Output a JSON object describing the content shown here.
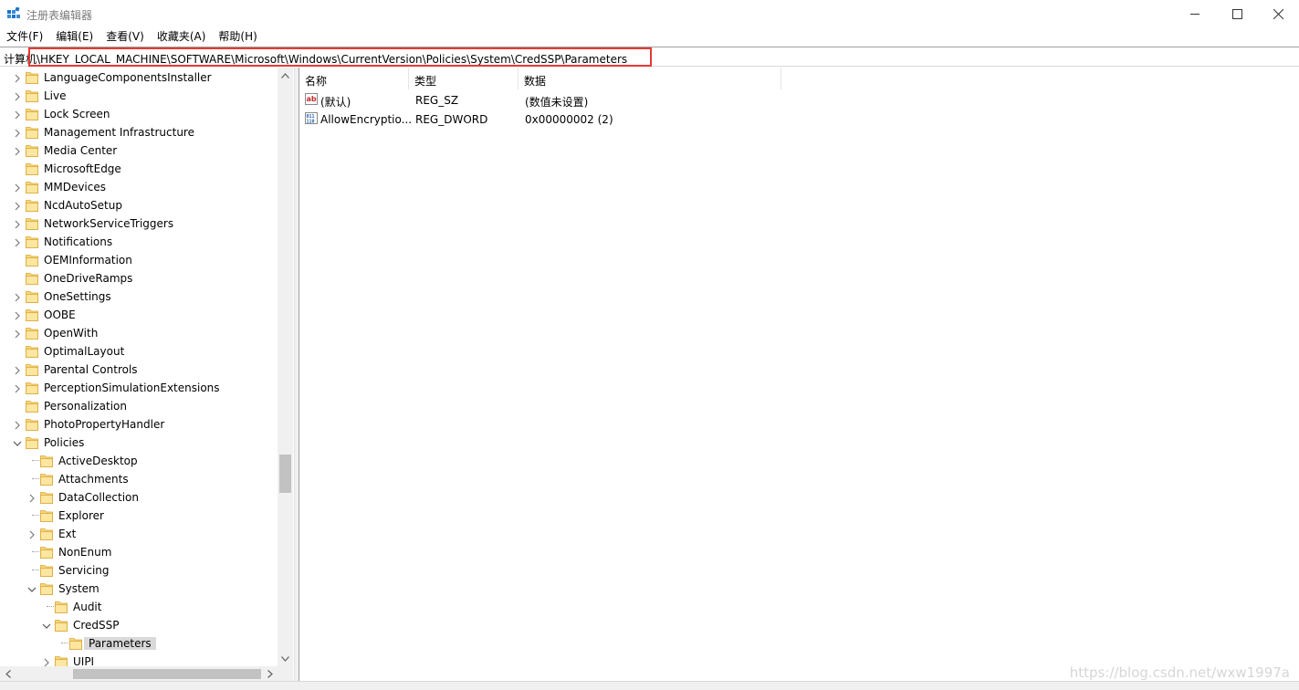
{
  "window": {
    "title": "注册表编辑器",
    "minimize_icon": "minimize-icon",
    "maximize_icon": "maximize-icon",
    "close_icon": "close-icon"
  },
  "menu": [
    "文件(F)",
    "编辑(E)",
    "查看(V)",
    "收藏夹(A)",
    "帮助(H)"
  ],
  "address": {
    "label": "计算",
    "value": "机\\HKEY_LOCAL_MACHINE\\SOFTWARE\\Microsoft\\Windows\\CurrentVersion\\Policies\\System\\CredSSP\\Parameters",
    "highlight_color": "#e53935"
  },
  "tree": [
    {
      "label": "LanguageComponentsInstaller",
      "level": 1,
      "expander": "collapsed"
    },
    {
      "label": "Live",
      "level": 1,
      "expander": "collapsed"
    },
    {
      "label": "Lock Screen",
      "level": 1,
      "expander": "collapsed"
    },
    {
      "label": "Management Infrastructure",
      "level": 1,
      "expander": "collapsed"
    },
    {
      "label": "Media Center",
      "level": 1,
      "expander": "collapsed"
    },
    {
      "label": "MicrosoftEdge",
      "level": 1,
      "expander": "none"
    },
    {
      "label": "MMDevices",
      "level": 1,
      "expander": "collapsed"
    },
    {
      "label": "NcdAutoSetup",
      "level": 1,
      "expander": "collapsed"
    },
    {
      "label": "NetworkServiceTriggers",
      "level": 1,
      "expander": "collapsed"
    },
    {
      "label": "Notifications",
      "level": 1,
      "expander": "collapsed"
    },
    {
      "label": "OEMInformation",
      "level": 1,
      "expander": "none"
    },
    {
      "label": "OneDriveRamps",
      "level": 1,
      "expander": "none"
    },
    {
      "label": "OneSettings",
      "level": 1,
      "expander": "collapsed"
    },
    {
      "label": "OOBE",
      "level": 1,
      "expander": "collapsed"
    },
    {
      "label": "OpenWith",
      "level": 1,
      "expander": "collapsed"
    },
    {
      "label": "OptimalLayout",
      "level": 1,
      "expander": "none"
    },
    {
      "label": "Parental Controls",
      "level": 1,
      "expander": "collapsed"
    },
    {
      "label": "PerceptionSimulationExtensions",
      "level": 1,
      "expander": "collapsed"
    },
    {
      "label": "Personalization",
      "level": 1,
      "expander": "none"
    },
    {
      "label": "PhotoPropertyHandler",
      "level": 1,
      "expander": "collapsed"
    },
    {
      "label": "Policies",
      "level": 1,
      "expander": "expanded"
    },
    {
      "label": "ActiveDesktop",
      "level": 2,
      "expander": "none"
    },
    {
      "label": "Attachments",
      "level": 2,
      "expander": "none"
    },
    {
      "label": "DataCollection",
      "level": 2,
      "expander": "collapsed"
    },
    {
      "label": "Explorer",
      "level": 2,
      "expander": "none"
    },
    {
      "label": "Ext",
      "level": 2,
      "expander": "collapsed"
    },
    {
      "label": "NonEnum",
      "level": 2,
      "expander": "none"
    },
    {
      "label": "Servicing",
      "level": 2,
      "expander": "none"
    },
    {
      "label": "System",
      "level": 2,
      "expander": "expanded"
    },
    {
      "label": "Audit",
      "level": 3,
      "expander": "none"
    },
    {
      "label": "CredSSP",
      "level": 3,
      "expander": "expanded"
    },
    {
      "label": "Parameters",
      "level": 4,
      "expander": "none",
      "selected": true
    },
    {
      "label": "UIPI",
      "level": 3,
      "expander": "collapsed"
    }
  ],
  "list": {
    "columns": [
      "名称",
      "类型",
      "数据"
    ],
    "rows": [
      {
        "icon": "string-value-icon",
        "name": "(默认)",
        "type": "REG_SZ",
        "data": "(数值未设置)"
      },
      {
        "icon": "binary-value-icon",
        "name": "AllowEncryptio...",
        "type": "REG_DWORD",
        "data": "0x00000002 (2)"
      }
    ]
  },
  "watermark": "https://blog.csdn.net/wxw1997a"
}
